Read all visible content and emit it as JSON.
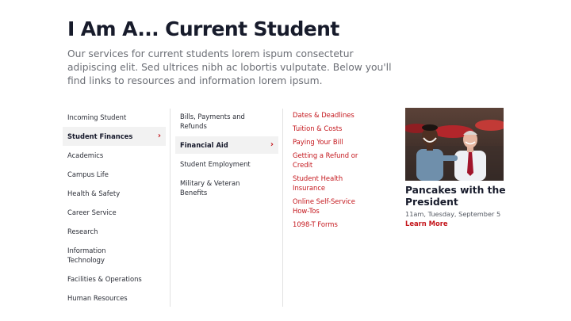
{
  "header": {
    "title": "I Am A... Current Student",
    "intro": "Our services for current students lorem ispum consectetur adipiscing elit. Sed ultrices nibh ac lobortis vulputate. Below you'll find links to resources and information lorem ipsum."
  },
  "audience_menu": {
    "items": [
      {
        "label": "Incoming Student"
      },
      {
        "label": "Student Finances",
        "active": true
      },
      {
        "label": "Academics"
      },
      {
        "label": "Campus Life"
      },
      {
        "label": "Health & Safety"
      },
      {
        "label": "Career Service"
      },
      {
        "label": "Research"
      },
      {
        "label": "Information Technology"
      },
      {
        "label": "Facilities & Operations"
      },
      {
        "label": "Human Resources"
      }
    ]
  },
  "finance_menu": {
    "items": [
      {
        "label": "Bills, Payments and Refunds"
      },
      {
        "label": "Financial Aid",
        "active": true
      },
      {
        "label": "Student Employment"
      },
      {
        "label": "Military & Veteran Benefits"
      }
    ]
  },
  "aid_links": {
    "items": [
      {
        "label": "Dates & Deadlines"
      },
      {
        "label": "Tuition & Costs"
      },
      {
        "label": "Paying Your Bill"
      },
      {
        "label": "Getting a Refund or Credit"
      },
      {
        "label": "Student Health Insurance"
      },
      {
        "label": "Online Self-Service How-Tos"
      },
      {
        "label": "1098-T Forms"
      }
    ]
  },
  "event": {
    "title": "Pancakes with the President",
    "time": "11am, Tuesday, September 5",
    "link_label": "Learn More"
  },
  "colors": {
    "accent": "#c4161c",
    "heading": "#171b2b",
    "active_bg": "#f2f2f2"
  },
  "icons": {
    "active_indicator": "chevron-right-icon"
  }
}
